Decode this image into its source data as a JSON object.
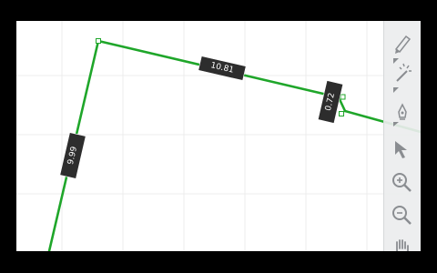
{
  "canvas": {
    "background": "#ffffff",
    "grid_color": "#ececec",
    "line_color": "#1fa62a",
    "label_bg": "#2d2d2d",
    "label_text_color": "#ffffff"
  },
  "segments": [
    {
      "name": "segment-left",
      "label": "9.99"
    },
    {
      "name": "segment-top",
      "label": "10.81"
    },
    {
      "name": "segment-short",
      "label": "0.72"
    }
  ],
  "toolbar": {
    "tools": [
      {
        "name": "pencil-tool",
        "icon": "pencil-icon"
      },
      {
        "name": "magic-wand-tool",
        "icon": "magic-wand-icon"
      },
      {
        "name": "pen-tool",
        "icon": "pen-nib-icon"
      },
      {
        "name": "select-tool",
        "icon": "cursor-arrow-icon"
      },
      {
        "name": "zoom-in-tool",
        "icon": "zoom-in-icon"
      },
      {
        "name": "zoom-out-tool",
        "icon": "zoom-out-icon"
      },
      {
        "name": "pan-tool",
        "icon": "hand-icon"
      }
    ]
  }
}
